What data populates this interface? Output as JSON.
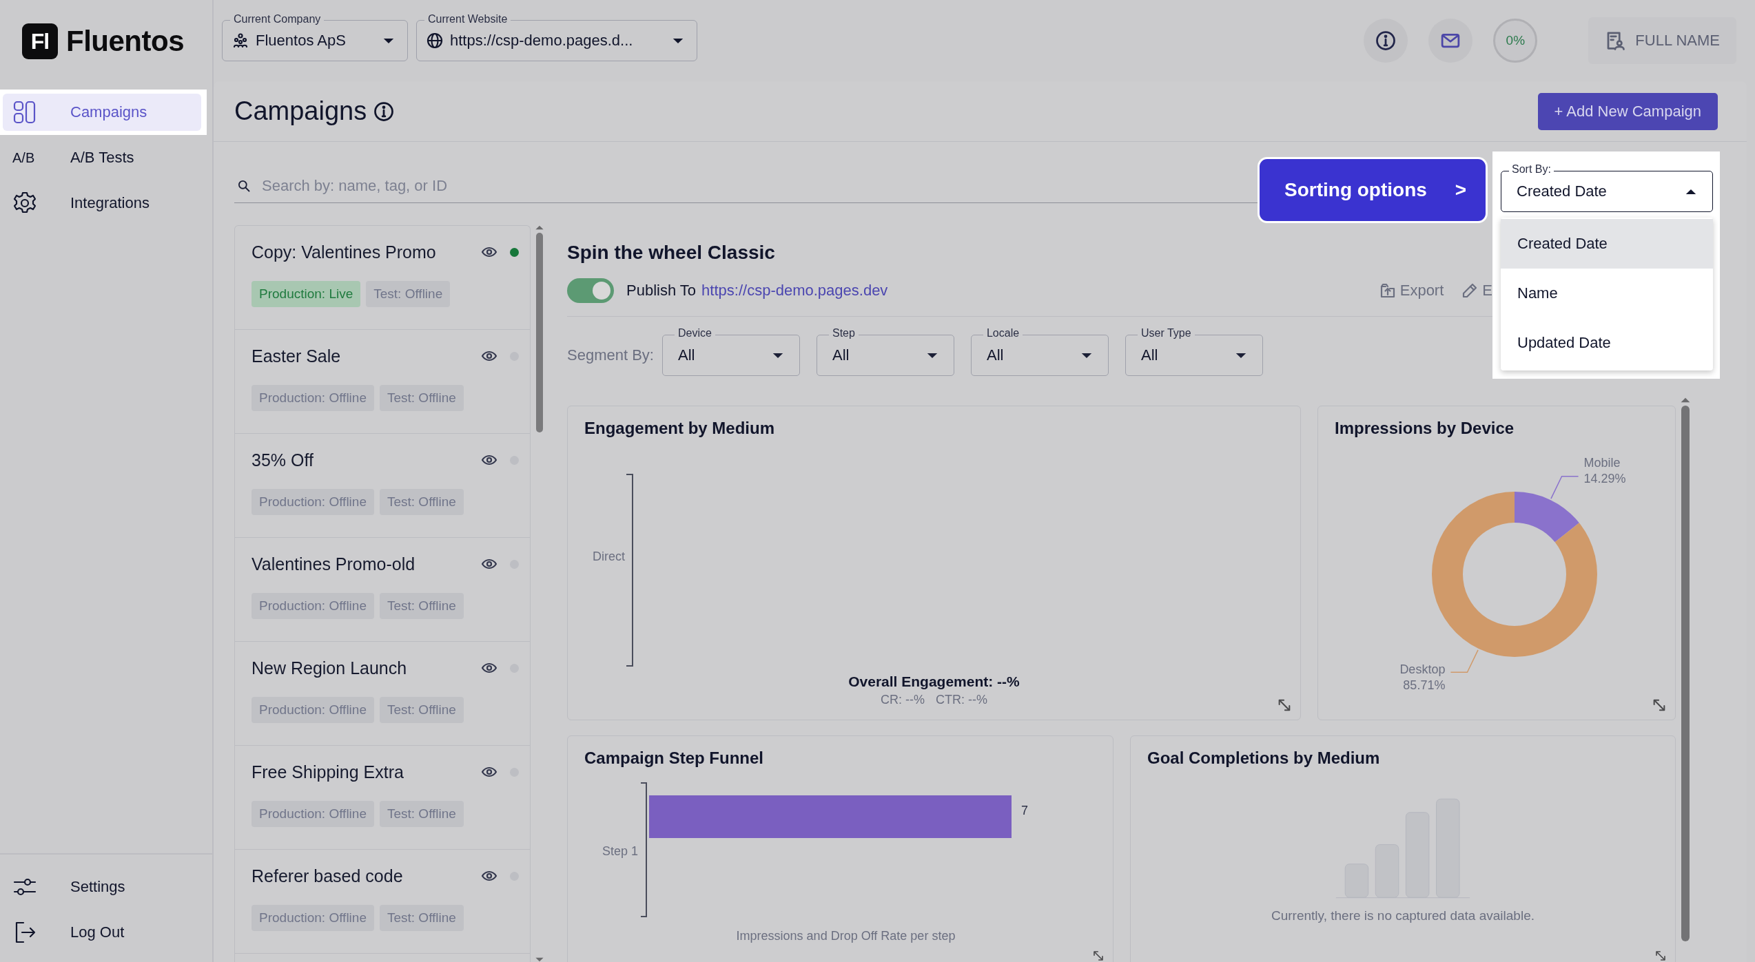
{
  "sidebar": {
    "logo": {
      "mark": "Fl",
      "name": "Fluentos"
    },
    "items": [
      {
        "label": "Campaigns",
        "selected": true
      },
      {
        "label": "A/B Tests",
        "icon_text": "A/B",
        "selected": false
      },
      {
        "label": "Integrations",
        "selected": false
      }
    ],
    "footer_items": [
      {
        "label": "Settings"
      },
      {
        "label": "Log Out"
      }
    ]
  },
  "topbar": {
    "company": {
      "label": "Current Company",
      "value": "Fluentos ApS"
    },
    "website": {
      "label": "Current Website",
      "value": "https://csp-demo.pages.d..."
    },
    "progress": "0%",
    "user": "FULL NAME"
  },
  "page": {
    "title": "Campaigns",
    "add_button": "+ Add New Campaign",
    "search": {
      "placeholder": "Search by: name, tag, or ID"
    }
  },
  "tutorial": {
    "label": "Sorting options",
    "arrow": ">"
  },
  "sort": {
    "label": "Sort By:",
    "value": "Created Date",
    "expanded": true,
    "options": [
      {
        "label": "Created Date",
        "selected": true
      },
      {
        "label": "Name",
        "selected": false
      },
      {
        "label": "Updated Date",
        "selected": false
      }
    ]
  },
  "campaigns": [
    {
      "name": "Copy: Valentines Promo",
      "live": true,
      "tags": [
        {
          "label": "Production: Live",
          "live": true
        },
        {
          "label": "Test: Offline",
          "live": false
        }
      ]
    },
    {
      "name": "Easter Sale",
      "live": false,
      "tags": [
        {
          "label": "Production: Offline",
          "live": false
        },
        {
          "label": "Test: Offline",
          "live": false
        }
      ]
    },
    {
      "name": "35% Off",
      "live": false,
      "tags": [
        {
          "label": "Production: Offline",
          "live": false
        },
        {
          "label": "Test: Offline",
          "live": false
        }
      ]
    },
    {
      "name": "Valentines Promo-old",
      "live": false,
      "tags": [
        {
          "label": "Production: Offline",
          "live": false
        },
        {
          "label": "Test: Offline",
          "live": false
        }
      ]
    },
    {
      "name": "New Region Launch",
      "live": false,
      "tags": [
        {
          "label": "Production: Offline",
          "live": false
        },
        {
          "label": "Test: Offline",
          "live": false
        }
      ]
    },
    {
      "name": "Free Shipping Extra",
      "live": false,
      "tags": [
        {
          "label": "Production: Offline",
          "live": false
        },
        {
          "label": "Test: Offline",
          "live": false
        }
      ]
    },
    {
      "name": "Referer based code",
      "live": false,
      "tags": [
        {
          "label": "Production: Offline",
          "live": false
        },
        {
          "label": "Test: Offline",
          "live": false
        }
      ]
    }
  ],
  "detail": {
    "title": "Spin the wheel Classic",
    "published": true,
    "publish_label": "Publish To",
    "publish_url": "https://csp-demo.pages.dev",
    "actions": [
      {
        "label": "Export"
      },
      {
        "label": "E"
      }
    ],
    "segment_label": "Segment By:",
    "segments": [
      {
        "label": "Device",
        "value": "All"
      },
      {
        "label": "Step",
        "value": "All"
      },
      {
        "label": "Locale",
        "value": "All"
      },
      {
        "label": "User Type",
        "value": "All"
      }
    ],
    "engagement": {
      "title": "Engagement by Medium",
      "axis_label": "Direct",
      "summary": "Overall Engagement: --%",
      "metrics": [
        "CR: --%",
        "CTR: --%"
      ]
    },
    "impressions": {
      "title": "Impressions by Device",
      "chart_data": {
        "type": "donut",
        "categories": [
          "Mobile",
          "Desktop"
        ],
        "values": [
          14.29,
          85.71
        ],
        "value_labels": [
          "14.29%",
          "85.71%"
        ]
      }
    },
    "funnel": {
      "title": "Campaign Step Funnel",
      "category": "Step 1",
      "value_label": "7",
      "caption": "Impressions and Drop Off Rate per step"
    },
    "goals": {
      "title": "Goal Completions by Medium",
      "empty_message": "Currently, there is no captured data available."
    }
  }
}
